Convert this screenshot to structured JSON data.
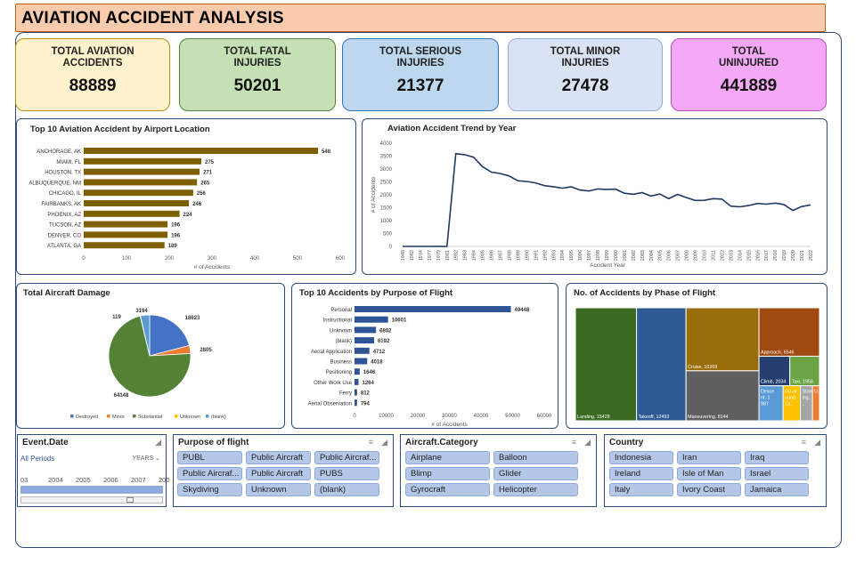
{
  "title": "AVIATION ACCIDENT ANALYSIS",
  "kpis": [
    {
      "label": "TOTAL AVIATION ACCIDENTS",
      "value": "88889",
      "color": "#fff2cc"
    },
    {
      "label": "TOTAL FATAL INJURIES",
      "value": "50201",
      "color": "#c5e0b4"
    },
    {
      "label": "TOTAL SERIOUS INJURIES",
      "value": "21377",
      "color": "#bdd7ee"
    },
    {
      "label": "TOTAL MINOR INJURIES",
      "value": "27478",
      "color": "#dae3f3"
    },
    {
      "label": "TOTAL UNINJURED",
      "value": "441889",
      "color": "#f4a9f7"
    }
  ],
  "panels": {
    "airport_title": "Top 10 Aviation Accident by Airport Location",
    "trend_title": "Aviation Accident Trend by Year",
    "damage_title": "Total Aircraft Damage",
    "purpose_title": "Top 10 Accidents by Purpose of Flight",
    "phase_title": "No. of Accidents by Phase of Flight"
  },
  "chart_data": [
    {
      "type": "bar",
      "title": "Top 10 Aviation Accident by Airport Location",
      "categories": [
        "ANCHORAGE, AK",
        "MIAMI, FL",
        "HOUSTON, TX",
        "ALBUQUERQUE, NM",
        "CHICAGO, IL",
        "FAIRBANKS, AK",
        "PHOENIX, AZ",
        "TUCSON, AZ",
        "DENVER, CO",
        "ATLANTA, GA"
      ],
      "values": [
        548,
        275,
        271,
        265,
        256,
        246,
        224,
        196,
        196,
        189
      ],
      "xlabel": "# of Accidents",
      "xticks": [
        "0",
        "100",
        "200",
        "300",
        "400",
        "500",
        "600"
      ],
      "xlim": [
        0,
        600
      ],
      "color": "#7f6000"
    },
    {
      "type": "line",
      "title": "Aviation Accident Trend by Year",
      "x": [
        "1948",
        "1962",
        "1974",
        "1977",
        "1979",
        "1981",
        "1982",
        "1983",
        "1984",
        "1985",
        "1986",
        "1987",
        "1988",
        "1989",
        "1990",
        "1991",
        "1992",
        "1993",
        "1994",
        "1995",
        "1996",
        "1997",
        "1998",
        "1999",
        "2000",
        "2001",
        "2002",
        "2003",
        "2004",
        "2005",
        "2006",
        "2007",
        "2008",
        "2009",
        "2010",
        "2011",
        "2012",
        "2013",
        "2014",
        "2015",
        "2016",
        "2017",
        "2018",
        "2019",
        "2020",
        "2021",
        "2022"
      ],
      "values": [
        1,
        1,
        1,
        1,
        2,
        1,
        3593,
        3556,
        3457,
        3096,
        2880,
        2828,
        2730,
        2544,
        2518,
        2462,
        2355,
        2313,
        2257,
        2309,
        2187,
        2148,
        2226,
        2209,
        2220,
        2063,
        2020,
        2085,
        1952,
        2031,
        1851,
        2016,
        1893,
        1783,
        1786,
        1850,
        1835,
        1561,
        1535,
        1582,
        1664,
        1638,
        1681,
        1624,
        1392,
        1545,
        1607
      ],
      "xlabel": "Accident Year",
      "ylabel": "# of Accidents",
      "yticks": [
        "0",
        "500",
        "1000",
        "1500",
        "2000",
        "2500",
        "3000",
        "3500",
        "4000"
      ],
      "ylim": [
        0,
        4000
      ],
      "color": "#203864"
    },
    {
      "type": "pie",
      "title": "Total Aircraft Damage",
      "labels": [
        "Destroyed",
        "Minor",
        "Substantial",
        "Unknown",
        "(blank)"
      ],
      "values": [
        18623,
        2805,
        64148,
        119,
        3194
      ],
      "colors": [
        "#4472c4",
        "#ed7d31",
        "#548235",
        "#ffc000",
        "#5b9bd5"
      ],
      "legend": "bottom"
    },
    {
      "type": "bar",
      "title": "Top 10 Accidents by Purpose of Flight",
      "categories": [
        "Personal",
        "Instructional",
        "Unknown",
        "(blank)",
        "Aerial Application",
        "Business",
        "Positioning",
        "Other Work Use",
        "Ferry",
        "Aerial Observation"
      ],
      "values": [
        49448,
        10601,
        6802,
        6192,
        4712,
        4018,
        1646,
        1264,
        812,
        794
      ],
      "xlabel": "# of Accidents",
      "xticks": [
        "0",
        "10000",
        "20000",
        "30000",
        "40000",
        "50000",
        "60000"
      ],
      "xlim": [
        0,
        60000
      ],
      "color": "#2f5597"
    },
    {
      "type": "heatmap",
      "title": "No. of Accidents by Phase of Flight",
      "labels": [
        "Landing",
        "Takeoff",
        "Cruise",
        "Maneuvering",
        "Approach",
        "Climb",
        "Taxi",
        "Descent",
        "Go-around",
        "Standing",
        "Unknown"
      ],
      "values": [
        15428,
        12493,
        10269,
        8144,
        6546,
        2034,
        1958,
        1887,
        1353,
        945,
        548
      ],
      "tile_labels": [
        "Landing, 15428",
        "Takeoff, 12493",
        "Cruise, 10269",
        "Maneuvering, 8144",
        "Approach, 6546",
        "Climb, 2034",
        "Taxi, 1958",
        "Descent, 1887",
        "Go-around, 13...",
        "Standing,...",
        "U..."
      ],
      "colors": [
        "#3b6b22",
        "#2e5b94",
        "#9a6d0b",
        "#5f5f5f",
        "#9e4a10",
        "#243f70",
        "#6aa444",
        "#5b9bd5",
        "#ffc000",
        "#a5a5a5",
        "#ed7d31"
      ]
    }
  ],
  "slicers": {
    "event_date": {
      "title": "Event.Date",
      "periods": "All Periods",
      "unit": "YEARS",
      "years": [
        "03",
        "2004",
        "2005",
        "2006",
        "2007",
        "200"
      ]
    },
    "purpose": {
      "title": "Purpose of flight",
      "items": [
        "PUBL",
        "Public Aircraft",
        "Public Aircraf...",
        "Public Aircraf...",
        "Public Aircraft",
        "PUBS",
        "Skydiving",
        "Unknown",
        "(blank)"
      ]
    },
    "category": {
      "title": "Aircraft.Category",
      "items": [
        "Airplane",
        "Balloon",
        "Blimp",
        "Glider",
        "Gyrocraft",
        "Helicopter"
      ]
    },
    "country": {
      "title": "Country",
      "items": [
        "Indonesia",
        "Iran",
        "Iraq",
        "Ireland",
        "Isle of Man",
        "Israel",
        "Italy",
        "Ivory Coast",
        "Jamaica"
      ]
    }
  }
}
